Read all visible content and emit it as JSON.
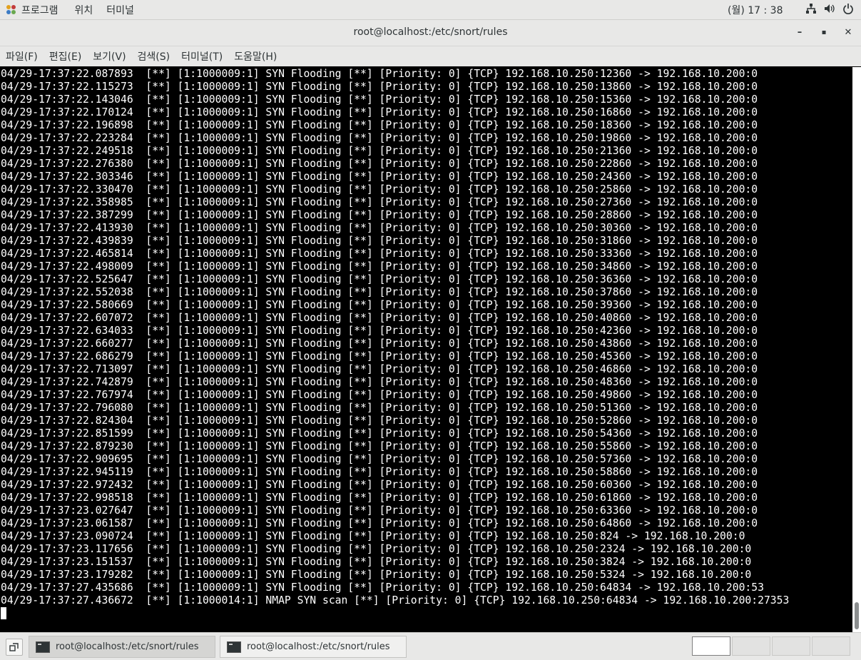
{
  "topbar": {
    "apps_label": "프로그램",
    "places_label": "위치",
    "app_menu_label": "터미널",
    "clock": "(월) 17 : 38"
  },
  "window": {
    "title": "root@localhost:/etc/snort/rules",
    "minimize": "–",
    "maximize": "▪",
    "close": "✕"
  },
  "menubar": {
    "file": "파일(F)",
    "edit": "편집(E)",
    "view": "보기(V)",
    "search": "검색(S)",
    "terminal": "터미널(T)",
    "help": "도움말(H)"
  },
  "terminal": {
    "lines": [
      "04/29-17:37:22.087893  [**] [1:1000009:1] SYN Flooding [**] [Priority: 0] {TCP} 192.168.10.250:12360 -> 192.168.10.200:0",
      "04/29-17:37:22.115273  [**] [1:1000009:1] SYN Flooding [**] [Priority: 0] {TCP} 192.168.10.250:13860 -> 192.168.10.200:0",
      "04/29-17:37:22.143046  [**] [1:1000009:1] SYN Flooding [**] [Priority: 0] {TCP} 192.168.10.250:15360 -> 192.168.10.200:0",
      "04/29-17:37:22.170124  [**] [1:1000009:1] SYN Flooding [**] [Priority: 0] {TCP} 192.168.10.250:16860 -> 192.168.10.200:0",
      "04/29-17:37:22.196898  [**] [1:1000009:1] SYN Flooding [**] [Priority: 0] {TCP} 192.168.10.250:18360 -> 192.168.10.200:0",
      "04/29-17:37:22.223284  [**] [1:1000009:1] SYN Flooding [**] [Priority: 0] {TCP} 192.168.10.250:19860 -> 192.168.10.200:0",
      "04/29-17:37:22.249518  [**] [1:1000009:1] SYN Flooding [**] [Priority: 0] {TCP} 192.168.10.250:21360 -> 192.168.10.200:0",
      "04/29-17:37:22.276380  [**] [1:1000009:1] SYN Flooding [**] [Priority: 0] {TCP} 192.168.10.250:22860 -> 192.168.10.200:0",
      "04/29-17:37:22.303346  [**] [1:1000009:1] SYN Flooding [**] [Priority: 0] {TCP} 192.168.10.250:24360 -> 192.168.10.200:0",
      "04/29-17:37:22.330470  [**] [1:1000009:1] SYN Flooding [**] [Priority: 0] {TCP} 192.168.10.250:25860 -> 192.168.10.200:0",
      "04/29-17:37:22.358985  [**] [1:1000009:1] SYN Flooding [**] [Priority: 0] {TCP} 192.168.10.250:27360 -> 192.168.10.200:0",
      "04/29-17:37:22.387299  [**] [1:1000009:1] SYN Flooding [**] [Priority: 0] {TCP} 192.168.10.250:28860 -> 192.168.10.200:0",
      "04/29-17:37:22.413930  [**] [1:1000009:1] SYN Flooding [**] [Priority: 0] {TCP} 192.168.10.250:30360 -> 192.168.10.200:0",
      "04/29-17:37:22.439839  [**] [1:1000009:1] SYN Flooding [**] [Priority: 0] {TCP} 192.168.10.250:31860 -> 192.168.10.200:0",
      "04/29-17:37:22.465814  [**] [1:1000009:1] SYN Flooding [**] [Priority: 0] {TCP} 192.168.10.250:33360 -> 192.168.10.200:0",
      "04/29-17:37:22.498009  [**] [1:1000009:1] SYN Flooding [**] [Priority: 0] {TCP} 192.168.10.250:34860 -> 192.168.10.200:0",
      "04/29-17:37:22.525647  [**] [1:1000009:1] SYN Flooding [**] [Priority: 0] {TCP} 192.168.10.250:36360 -> 192.168.10.200:0",
      "04/29-17:37:22.552038  [**] [1:1000009:1] SYN Flooding [**] [Priority: 0] {TCP} 192.168.10.250:37860 -> 192.168.10.200:0",
      "04/29-17:37:22.580669  [**] [1:1000009:1] SYN Flooding [**] [Priority: 0] {TCP} 192.168.10.250:39360 -> 192.168.10.200:0",
      "04/29-17:37:22.607072  [**] [1:1000009:1] SYN Flooding [**] [Priority: 0] {TCP} 192.168.10.250:40860 -> 192.168.10.200:0",
      "04/29-17:37:22.634033  [**] [1:1000009:1] SYN Flooding [**] [Priority: 0] {TCP} 192.168.10.250:42360 -> 192.168.10.200:0",
      "04/29-17:37:22.660277  [**] [1:1000009:1] SYN Flooding [**] [Priority: 0] {TCP} 192.168.10.250:43860 -> 192.168.10.200:0",
      "04/29-17:37:22.686279  [**] [1:1000009:1] SYN Flooding [**] [Priority: 0] {TCP} 192.168.10.250:45360 -> 192.168.10.200:0",
      "04/29-17:37:22.713097  [**] [1:1000009:1] SYN Flooding [**] [Priority: 0] {TCP} 192.168.10.250:46860 -> 192.168.10.200:0",
      "04/29-17:37:22.742879  [**] [1:1000009:1] SYN Flooding [**] [Priority: 0] {TCP} 192.168.10.250:48360 -> 192.168.10.200:0",
      "04/29-17:37:22.767974  [**] [1:1000009:1] SYN Flooding [**] [Priority: 0] {TCP} 192.168.10.250:49860 -> 192.168.10.200:0",
      "04/29-17:37:22.796080  [**] [1:1000009:1] SYN Flooding [**] [Priority: 0] {TCP} 192.168.10.250:51360 -> 192.168.10.200:0",
      "04/29-17:37:22.824304  [**] [1:1000009:1] SYN Flooding [**] [Priority: 0] {TCP} 192.168.10.250:52860 -> 192.168.10.200:0",
      "04/29-17:37:22.851599  [**] [1:1000009:1] SYN Flooding [**] [Priority: 0] {TCP} 192.168.10.250:54360 -> 192.168.10.200:0",
      "04/29-17:37:22.879230  [**] [1:1000009:1] SYN Flooding [**] [Priority: 0] {TCP} 192.168.10.250:55860 -> 192.168.10.200:0",
      "04/29-17:37:22.909695  [**] [1:1000009:1] SYN Flooding [**] [Priority: 0] {TCP} 192.168.10.250:57360 -> 192.168.10.200:0",
      "04/29-17:37:22.945119  [**] [1:1000009:1] SYN Flooding [**] [Priority: 0] {TCP} 192.168.10.250:58860 -> 192.168.10.200:0",
      "04/29-17:37:22.972432  [**] [1:1000009:1] SYN Flooding [**] [Priority: 0] {TCP} 192.168.10.250:60360 -> 192.168.10.200:0",
      "04/29-17:37:22.998518  [**] [1:1000009:1] SYN Flooding [**] [Priority: 0] {TCP} 192.168.10.250:61860 -> 192.168.10.200:0",
      "04/29-17:37:23.027647  [**] [1:1000009:1] SYN Flooding [**] [Priority: 0] {TCP} 192.168.10.250:63360 -> 192.168.10.200:0",
      "04/29-17:37:23.061587  [**] [1:1000009:1] SYN Flooding [**] [Priority: 0] {TCP} 192.168.10.250:64860 -> 192.168.10.200:0",
      "04/29-17:37:23.090724  [**] [1:1000009:1] SYN Flooding [**] [Priority: 0] {TCP} 192.168.10.250:824 -> 192.168.10.200:0",
      "04/29-17:37:23.117656  [**] [1:1000009:1] SYN Flooding [**] [Priority: 0] {TCP} 192.168.10.250:2324 -> 192.168.10.200:0",
      "04/29-17:37:23.151537  [**] [1:1000009:1] SYN Flooding [**] [Priority: 0] {TCP} 192.168.10.250:3824 -> 192.168.10.200:0",
      "04/29-17:37:23.179282  [**] [1:1000009:1] SYN Flooding [**] [Priority: 0] {TCP} 192.168.10.250:5324 -> 192.168.10.200:0",
      "04/29-17:37:27.435686  [**] [1:1000009:1] SYN Flooding [**] [Priority: 0] {TCP} 192.168.10.250:64834 -> 192.168.10.200:53",
      "04/29-17:37:27.436672  [**] [1:1000014:1] NMAP SYN scan [**] [Priority: 0] {TCP} 192.168.10.250:64834 -> 192.168.10.200:27353"
    ]
  },
  "taskbar": {
    "tasks": [
      {
        "label": "root@localhost:/etc/snort/rules"
      },
      {
        "label": "root@localhost:/etc/snort/rules"
      }
    ]
  }
}
